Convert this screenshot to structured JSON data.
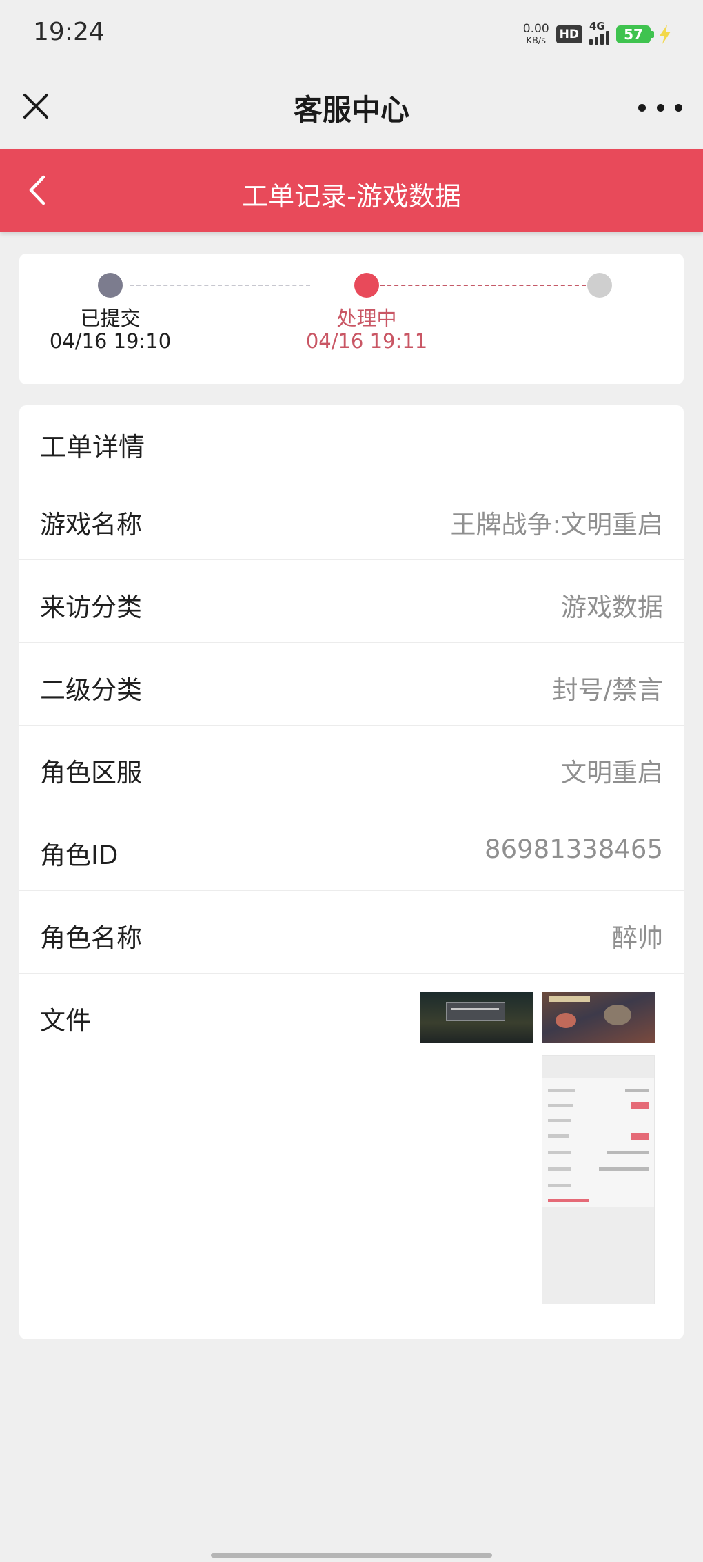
{
  "status_bar": {
    "time": "19:24",
    "net_speed_value": "0.00",
    "net_speed_unit": "KB/s",
    "hd_badge": "HD",
    "network": "4G",
    "battery": "57",
    "charging_icon": "lightning-bolt-icon"
  },
  "title_bar": {
    "title": "客服中心",
    "close_icon": "close-icon",
    "more_icon": "more-dots-icon"
  },
  "header": {
    "title": "工单记录-游戏数据",
    "back_icon": "chevron-left-icon",
    "color": "#e84a5a"
  },
  "progress": {
    "steps": [
      {
        "label": "已提交",
        "time": "04/16 19:10",
        "state": "done",
        "color": "#7c7c8e"
      },
      {
        "label": "处理中",
        "time": "04/16 19:11",
        "state": "active",
        "color": "#e84a5a"
      },
      {
        "label": "",
        "time": "",
        "state": "pending",
        "color": "#cfcfcf"
      }
    ]
  },
  "detail": {
    "title": "工单详情",
    "rows": [
      {
        "key": "游戏名称",
        "value": "王牌战争:文明重启"
      },
      {
        "key": "来访分类",
        "value": "游戏数据"
      },
      {
        "key": "二级分类",
        "value": "封号/禁言"
      },
      {
        "key": "角色区服",
        "value": "文明重启"
      },
      {
        "key": "角色ID",
        "value": "86981338465"
      },
      {
        "key": "角色名称",
        "value": "醉帅"
      }
    ],
    "files_label": "文件"
  }
}
